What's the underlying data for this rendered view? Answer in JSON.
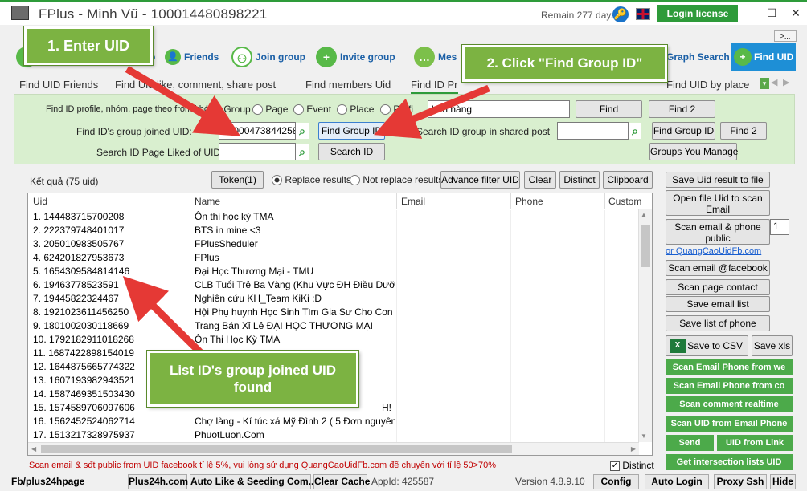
{
  "window": {
    "title": "FPlus - Minh Vũ - 100014480898221",
    "remain": "Remain 277 days",
    "login_label": "Login license",
    "more_label": ">..."
  },
  "toolbar": {
    "friends": "Friends",
    "join_group": "Join group",
    "invite_group": "Invite group",
    "messages_partial": "Mes",
    "graph_search": "Graph Search",
    "find_uid": "Find UID",
    "partial_p": "p"
  },
  "tabs": [
    "Find UID Friends",
    "Find Uid like, comment, share post",
    "Find members Uid",
    "Find ID Pr",
    "Find UID by place"
  ],
  "panel": {
    "find_profile_label": "Find ID profile, nhóm, page theo from khóa",
    "radio_group": "Group",
    "radio_page": "Page",
    "radio_event": "Event",
    "radio_place": "Place",
    "radio_profile": "Profi",
    "keyword_value": "bán hàng",
    "find_btn": "Find",
    "find2_btn": "Find 2",
    "joined_label": "Find ID's group joined UID:",
    "joined_value": "100004738442580",
    "find_group_id_btn": "Find Group ID",
    "shared_label": "Search ID group in shared post",
    "find_group_id_btn2": "Find Group ID",
    "find2_btn2": "Find 2",
    "liked_label": "Search ID Page Liked of UID:",
    "search_id_btn": "Search ID",
    "groups_manage_btn": "Groups You Manage"
  },
  "results": {
    "label": "Kết quả (75 uid)",
    "token_btn": "Token(1)",
    "replace": "Replace results",
    "not_replace": "Not replace results",
    "advance_filter": "Advance filter UID",
    "clear": "Clear",
    "distinct": "Distinct",
    "clipboard": "Clipboard",
    "columns": [
      "Uid",
      "Name",
      "Email",
      "Phone",
      "Custom"
    ],
    "rows": [
      {
        "uid": "1. 144483715700208",
        "name": "Ôn thi học kỳ TMA"
      },
      {
        "uid": "2. 222379748401017",
        "name": "BTS in mine <3"
      },
      {
        "uid": "3. 205010983505767",
        "name": "FPlusSheduler"
      },
      {
        "uid": "4. 624201827953673",
        "name": "FPlus"
      },
      {
        "uid": "5. 1654309584814146",
        "name": "Đại Học Thương Mại - TMU"
      },
      {
        "uid": "6. 19463778523591",
        "name": "CLB Tuổi Trẻ Ba Vàng (Khu Vực ĐH Điều Dưỡng ..."
      },
      {
        "uid": "7. 19445822324467",
        "name": "Nghiên cứu KH_Team KiKi :D"
      },
      {
        "uid": "8. 1921023611456250",
        "name": "Hội Phụ huynh Học Sinh Tìm Gia Sư Cho Con"
      },
      {
        "uid": "9. 1801002030118669",
        "name": "Trang Bán Xỉ Lẻ ĐẠI HỌC THƯƠNG MẠI"
      },
      {
        "uid": "10. 1792182911018268",
        "name": "Ôn Thi Học Kỳ TMA"
      },
      {
        "uid": "11. 1687422898154019",
        "name": ""
      },
      {
        "uid": "12. 1644875665774322",
        "name": ""
      },
      {
        "uid": "13. 1607193982943521",
        "name": ""
      },
      {
        "uid": "14. 1587469351503430",
        "name": ""
      },
      {
        "uid": "15. 1574589706097606",
        "name": "H!"
      },
      {
        "uid": "16. 1562452524062714",
        "name": "Chợ làng - Kí túc xá Mỹ Đình 2 ( 5 Đơn nguyên )"
      },
      {
        "uid": "17. 1513217328975937",
        "name": "PhuotLuon.Com"
      }
    ],
    "status_line": "Scan email & sđt public from UID facebook tỉ lệ 5%, vui lòng sử dụng QuangCaoUidFb.com để chuyển với tỉ lệ 50>70%",
    "distinct_bottom": "Distinct"
  },
  "right_panel": {
    "save_uid": "Save Uid result to file",
    "open_file": "Open file Uid to scan Email",
    "scan_email_phone": "Scan email & phone public",
    "spinner_value": "1",
    "link": "or QuangCaoUidFb.com",
    "scan_email_fb": "Scan email @facebook",
    "scan_page": "Scan page contact",
    "save_email": "Save email list",
    "save_phone": "Save list of phone",
    "save_csv": "Save to CSV",
    "save_xls": "Save xls",
    "green": [
      "Scan Email Phone from we",
      "Scan Email Phone from co",
      "Scan comment realtime",
      "Scan UID from Email Phone"
    ],
    "send": "Send",
    "uid_from_link": "UID from Link",
    "intersection": "Get intersection lists UID"
  },
  "bottom": {
    "fb_link": "Fb/plus24hpage",
    "plus24h": "Plus24h.com",
    "auto_like": "Auto Like & Seeding Com...",
    "clear_cache": "Clear Cache",
    "appid": "AppId: 425587",
    "version": "Version 4.8.9.10",
    "config": "Config",
    "auto_login": "Auto Login",
    "proxy": "Proxy Ssh",
    "hide": "Hide"
  },
  "callouts": {
    "step1": "1. Enter UID",
    "step2": "2. Click \"Find Group ID\"",
    "step3": "List ID's group joined UID found"
  },
  "colors": {
    "accent_green": "#2e9b3a",
    "panel_green": "#d9efcf",
    "callout_green": "#7cb342",
    "arrow_red": "#e53935",
    "find_uid_blue": "#1e8fd6"
  }
}
